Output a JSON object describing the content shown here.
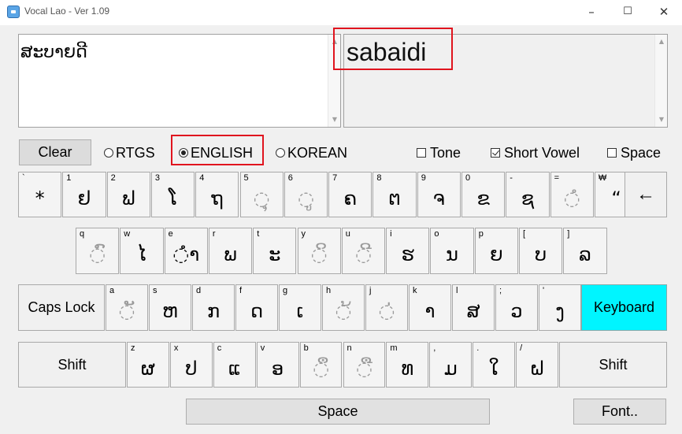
{
  "window": {
    "title": "Vocal Lao - Ver 1.09",
    "min": "–",
    "max": "☐",
    "close": "✕"
  },
  "output": {
    "lao_text": "ສະບາຍດີ",
    "latin_text": "sabaidi"
  },
  "controls": {
    "clear": "Clear",
    "modes": [
      {
        "label": "RTGS",
        "selected": false
      },
      {
        "label": "ENGLISH",
        "selected": true
      },
      {
        "label": "KOREAN",
        "selected": false
      }
    ],
    "options": [
      {
        "label": "Tone",
        "checked": false
      },
      {
        "label": "Short Vowel",
        "checked": true
      },
      {
        "label": "Space",
        "checked": false
      }
    ]
  },
  "keyboard": {
    "row1": [
      {
        "shift": "`",
        "char": "*"
      },
      {
        "shift": "1",
        "char": "ຢ"
      },
      {
        "shift": "2",
        "char": "ຟ"
      },
      {
        "shift": "3",
        "char": "ໂ"
      },
      {
        "shift": "4",
        "char": "ຖ"
      },
      {
        "shift": "5",
        "char": "◌ຸ",
        "dim": true
      },
      {
        "shift": "6",
        "char": "◌ູ",
        "dim": true
      },
      {
        "shift": "7",
        "char": "ຄ"
      },
      {
        "shift": "8",
        "char": "ຕ"
      },
      {
        "shift": "9",
        "char": "ຈ"
      },
      {
        "shift": "0",
        "char": "ຂ"
      },
      {
        "shift": "-",
        "char": "ຊ"
      },
      {
        "shift": "=",
        "char": "◌ໍ",
        "dim": true
      },
      {
        "shift": "₩",
        "char": "“"
      }
    ],
    "backspace": "←",
    "row2": [
      {
        "shift": "q",
        "char": "◌ົ",
        "dim": true
      },
      {
        "shift": "w",
        "char": "ໄ"
      },
      {
        "shift": "e",
        "char": "◌ຳ"
      },
      {
        "shift": "r",
        "char": "ພ"
      },
      {
        "shift": "t",
        "char": "ະ"
      },
      {
        "shift": "y",
        "char": "◌ິ",
        "dim": true
      },
      {
        "shift": "u",
        "char": "◌ີ",
        "dim": true
      },
      {
        "shift": "i",
        "char": "ຮ"
      },
      {
        "shift": "o",
        "char": "ນ"
      },
      {
        "shift": "p",
        "char": "ຍ"
      },
      {
        "shift": "[",
        "char": "ບ"
      },
      {
        "shift": "]",
        "char": "ລ"
      }
    ],
    "caps_lock": "Caps Lock",
    "row3": [
      {
        "shift": "a",
        "char": "◌ັ",
        "dim": true
      },
      {
        "shift": "s",
        "char": "ຫ"
      },
      {
        "shift": "d",
        "char": "ກ"
      },
      {
        "shift": "f",
        "char": "ດ"
      },
      {
        "shift": "g",
        "char": "ເ"
      },
      {
        "shift": "h",
        "char": "◌້",
        "dim": true
      },
      {
        "shift": "j",
        "char": "◌່",
        "dim": true
      },
      {
        "shift": "k",
        "char": "າ"
      },
      {
        "shift": "l",
        "char": "ສ"
      },
      {
        "shift": ";",
        "char": "ວ"
      },
      {
        "shift": "'",
        "char": "ງ"
      }
    ],
    "keyboard_btn": "Keyboard",
    "shift_left": "Shift",
    "row4": [
      {
        "shift": "z",
        "char": "ຜ"
      },
      {
        "shift": "x",
        "char": "ປ"
      },
      {
        "shift": "c",
        "char": "ແ"
      },
      {
        "shift": "v",
        "char": "ອ"
      },
      {
        "shift": "b",
        "char": "◌ຶ",
        "dim": true
      },
      {
        "shift": "n",
        "char": "◌ື",
        "dim": true
      },
      {
        "shift": "m",
        "char": "ທ"
      },
      {
        "shift": ",",
        "char": "ມ"
      },
      {
        "shift": ".",
        "char": "ໃ"
      },
      {
        "shift": "/",
        "char": "ຝ"
      }
    ],
    "shift_right": "Shift"
  },
  "bottom": {
    "space": "Space",
    "font": "Font.."
  }
}
